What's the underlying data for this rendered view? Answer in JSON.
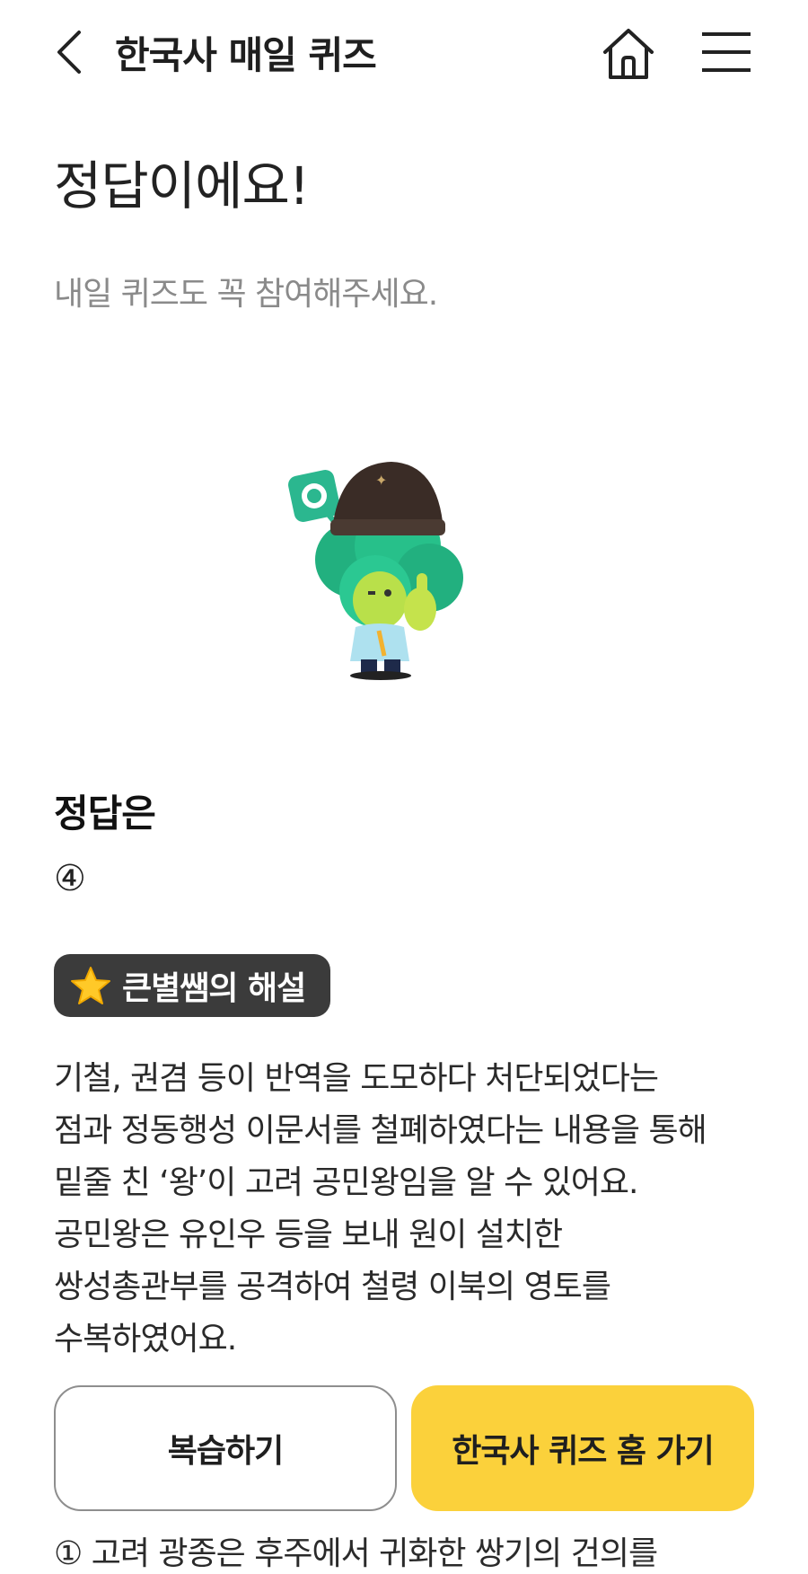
{
  "header": {
    "title": "한국사 매일 퀴즈",
    "back_icon": "chevron-left-icon",
    "home_icon": "home-icon",
    "menu_icon": "hamburger-menu-icon"
  },
  "result": {
    "headline": "정답이에요!",
    "subtext": "내일 퀴즈도 꼭 참여해주세요."
  },
  "answer": {
    "heading": "정답은",
    "value": "④"
  },
  "explanation": {
    "badge_label": "큰별쌤의 해설",
    "badge_icon": "star-icon",
    "lines": [
      "기철, 권겸 등이 반역을 도모하다 처단되었다는",
      "점과 정동행성 이문서를 철폐하였다는 내용을 통해",
      "밑줄 친 ‘왕’이 고려 공민왕임을 알 수 있어요.",
      "공민왕은 유인우 등을 보내 원이 설치한",
      "쌍성총관부를 공격하여 철령 이북의 영토를",
      "수복하였어요."
    ]
  },
  "buttons": {
    "review": "복습하기",
    "quiz_home": "한국사 퀴즈 홈 가기"
  },
  "choices": {
    "first": "① 고려 광종은 후주에서 귀화한 쌍기의 건의를"
  },
  "colors": {
    "accent_yellow": "#fbd13b",
    "badge_bg": "#3b3b3b",
    "subtext_gray": "#8a8a8a"
  }
}
